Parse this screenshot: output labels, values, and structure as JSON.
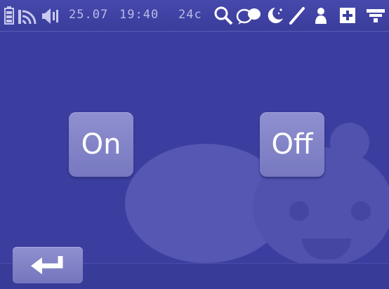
{
  "status_bar": {
    "date": "25.07",
    "time": "19:40",
    "temperature": "24c",
    "icons": [
      "battery-icon",
      "signal-icon",
      "speaker-icon",
      "search-icon",
      "chat-bubble-icon",
      "moon-icon",
      "pen-icon",
      "person-icon",
      "plus-box-icon",
      "menu-icon"
    ]
  },
  "main": {
    "on_label": "On",
    "off_label": "Off"
  },
  "bottom_bar": {
    "back_icon": "return-arrow-icon"
  },
  "colors": {
    "background": "#3c3e9f",
    "button": "#8283c6",
    "status_text": "#b9bae8"
  }
}
